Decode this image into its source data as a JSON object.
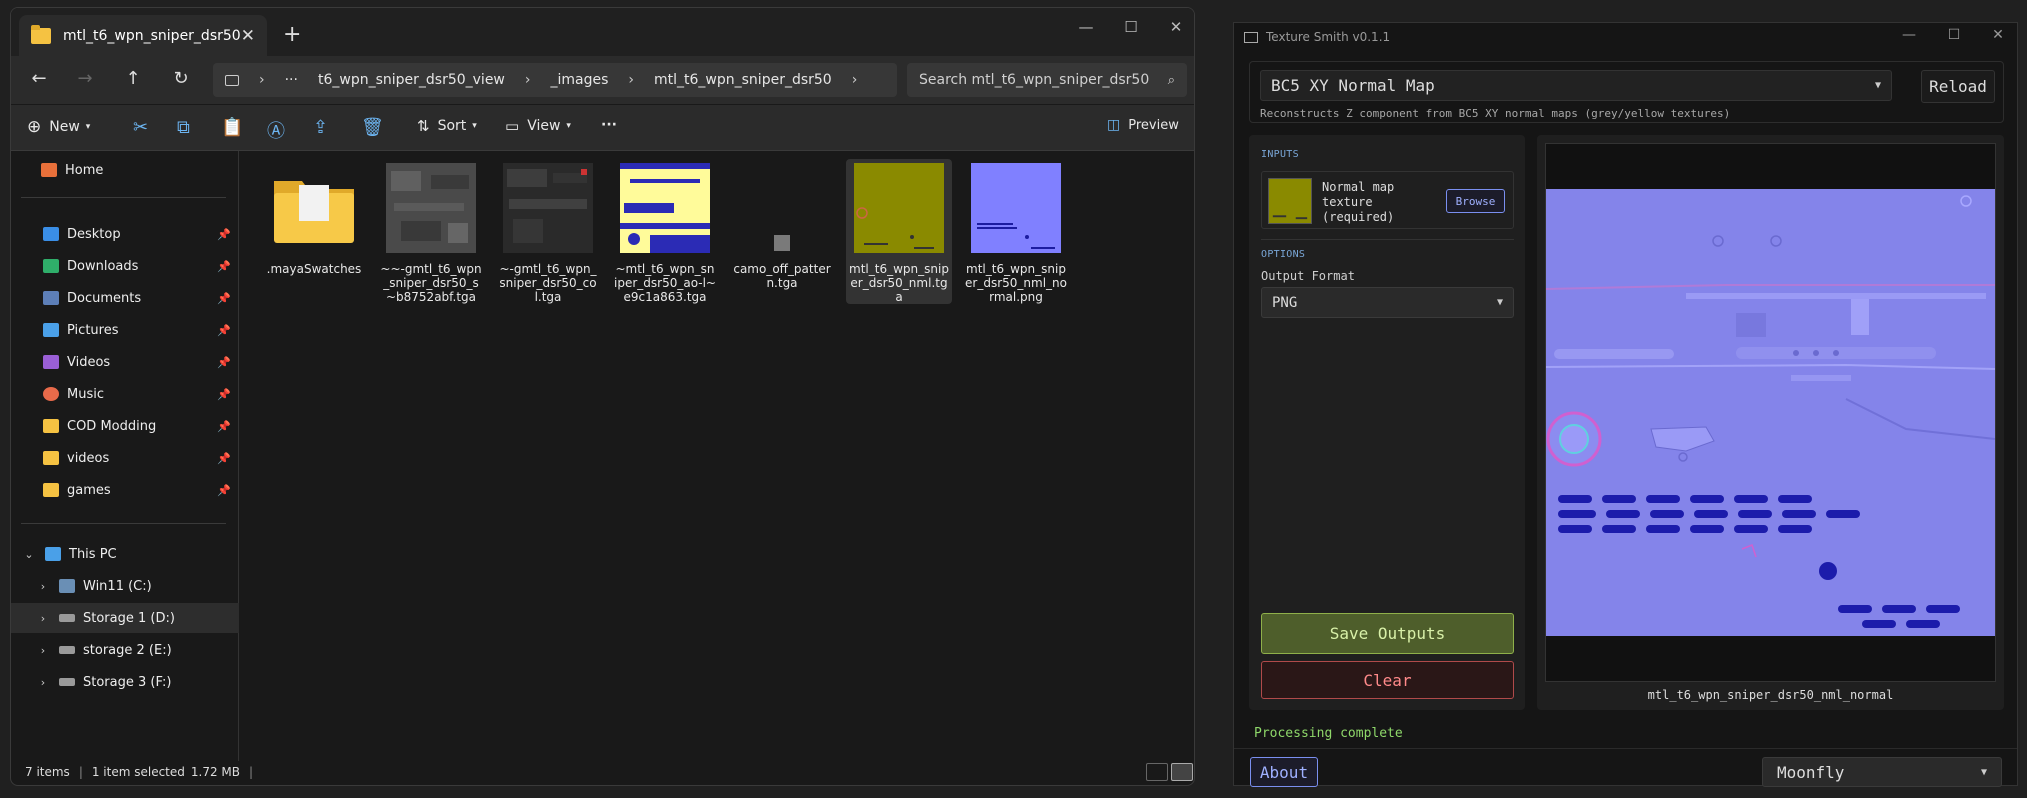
{
  "explorer": {
    "tab_title": "mtl_t6_wpn_sniper_dsr50",
    "breadcrumb": [
      "t6_wpn_sniper_dsr50_view",
      "_images",
      "mtl_t6_wpn_sniper_dsr50"
    ],
    "breadcrumb_more": "···",
    "search_placeholder": "Search mtl_t6_wpn_sniper_dsr50",
    "toolbar": {
      "new_label": "New",
      "sort_label": "Sort",
      "view_label": "View",
      "more_label": "···",
      "preview_label": "Preview"
    },
    "sidebar": {
      "home": "Home",
      "quick": [
        {
          "label": "Desktop",
          "color": "#3a8ee6"
        },
        {
          "label": "Downloads",
          "color": "#2fae6a"
        },
        {
          "label": "Documents",
          "color": "#5d7fb8"
        },
        {
          "label": "Pictures",
          "color": "#4aa0e8"
        },
        {
          "label": "Videos",
          "color": "#9a5fd6"
        },
        {
          "label": "Music",
          "color": "#e86a4a"
        },
        {
          "label": "COD Modding",
          "color": "#f5c242"
        },
        {
          "label": "videos",
          "color": "#f5c242"
        },
        {
          "label": "games",
          "color": "#f5c242"
        }
      ],
      "this_pc": "This PC",
      "drives": [
        "Win11 (C:)",
        "Storage 1 (D:)",
        "storage 2 (E:)",
        "Storage 3 (F:)"
      ]
    },
    "files": [
      {
        "name": ".mayaSwatches",
        "kind": "folder"
      },
      {
        "name": "~~-gmtl_t6_wpn_sniper_dsr50_s~b8752abf.tga",
        "kind": "gray"
      },
      {
        "name": "~-gmtl_t6_wpn_sniper_dsr50_col.tga",
        "kind": "dark"
      },
      {
        "name": "~mtl_t6_wpn_sniper_dsr50_ao-l~e9c1a863.tga",
        "kind": "ao"
      },
      {
        "name": "camo_off_pattern.tga",
        "kind": "small"
      },
      {
        "name": "mtl_t6_wpn_sniper_dsr50_nml.tga",
        "kind": "yellow"
      },
      {
        "name": "mtl_t6_wpn_sniper_dsr50_nml_normal.png",
        "kind": "normal"
      }
    ],
    "status": {
      "items": "7 items",
      "selected": "1 item selected",
      "size": "1.72 MB"
    }
  },
  "texture_smith": {
    "window_title": "Texture Smith v0.1.1",
    "mode": "BC5 XY Normal Map",
    "reload_label": "Reload",
    "description": "Reconstructs Z component from BC5 XY normal maps (grey/yellow textures)",
    "inputs_heading": "INPUTS",
    "input_label_line1": "Normal map",
    "input_label_line2": "texture",
    "input_label_line3": "(required)",
    "browse_label": "Browse",
    "options_heading": "OPTIONS",
    "output_format_label": "Output Format",
    "output_format_value": "PNG",
    "save_label": "Save Outputs",
    "clear_label": "Clear",
    "preview_name": "mtl_t6_wpn_sniper_dsr50_nml_normal",
    "status": "Processing complete",
    "about_label": "About",
    "theme": "Moonfly"
  }
}
